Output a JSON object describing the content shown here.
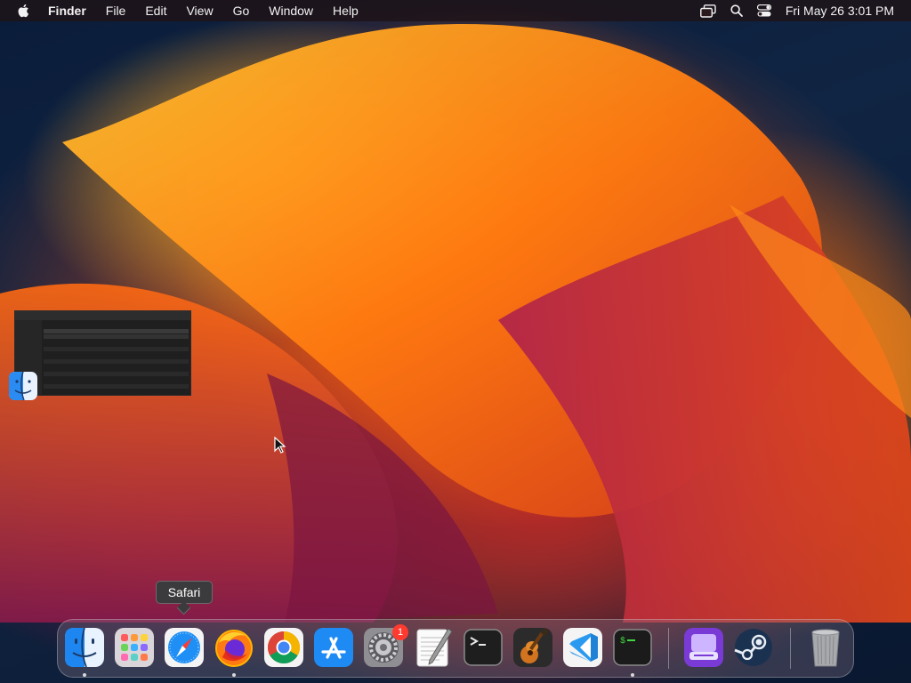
{
  "menubar": {
    "items": [
      "Finder",
      "File",
      "Edit",
      "View",
      "Go",
      "Window",
      "Help"
    ],
    "clock": "Fri May 26  3:01 PM",
    "status_icons": [
      "screen-mirroring-icon",
      "search-icon",
      "control-center-icon"
    ]
  },
  "tooltip": {
    "label": "Safari"
  },
  "dock": {
    "apps": [
      {
        "name": "Finder",
        "icon": "finder-icon",
        "running": true
      },
      {
        "name": "Launchpad",
        "icon": "launchpad-icon",
        "running": false
      },
      {
        "name": "Safari",
        "icon": "safari-icon",
        "running": false
      },
      {
        "name": "Firefox",
        "icon": "firefox-icon",
        "running": true
      },
      {
        "name": "Google Chrome",
        "icon": "chrome-icon",
        "running": false
      },
      {
        "name": "App Store",
        "icon": "app-store-icon",
        "running": false
      },
      {
        "name": "System Preferences",
        "icon": "system-preferences-icon",
        "running": false,
        "badge": "1"
      },
      {
        "name": "TextEdit",
        "icon": "textedit-icon",
        "running": false
      },
      {
        "name": "Terminal",
        "icon": "terminal-icon",
        "running": false
      },
      {
        "name": "GarageBand",
        "icon": "garageband-icon",
        "running": false
      },
      {
        "name": "Visual Studio Code",
        "icon": "vscode-icon",
        "running": false
      },
      {
        "name": "Terminal (running)",
        "icon": "terminal-green-icon",
        "running": true
      },
      {
        "name": "Installer",
        "icon": "installer-icon",
        "running": false
      },
      {
        "name": "Steam",
        "icon": "steam-icon",
        "running": false
      },
      {
        "name": "Trash",
        "icon": "trash-icon",
        "running": false
      }
    ]
  },
  "colors": {
    "menubar_bg": "#1e1216",
    "accent_orange": "#ff7a10",
    "badge_red": "#ff3b30"
  }
}
